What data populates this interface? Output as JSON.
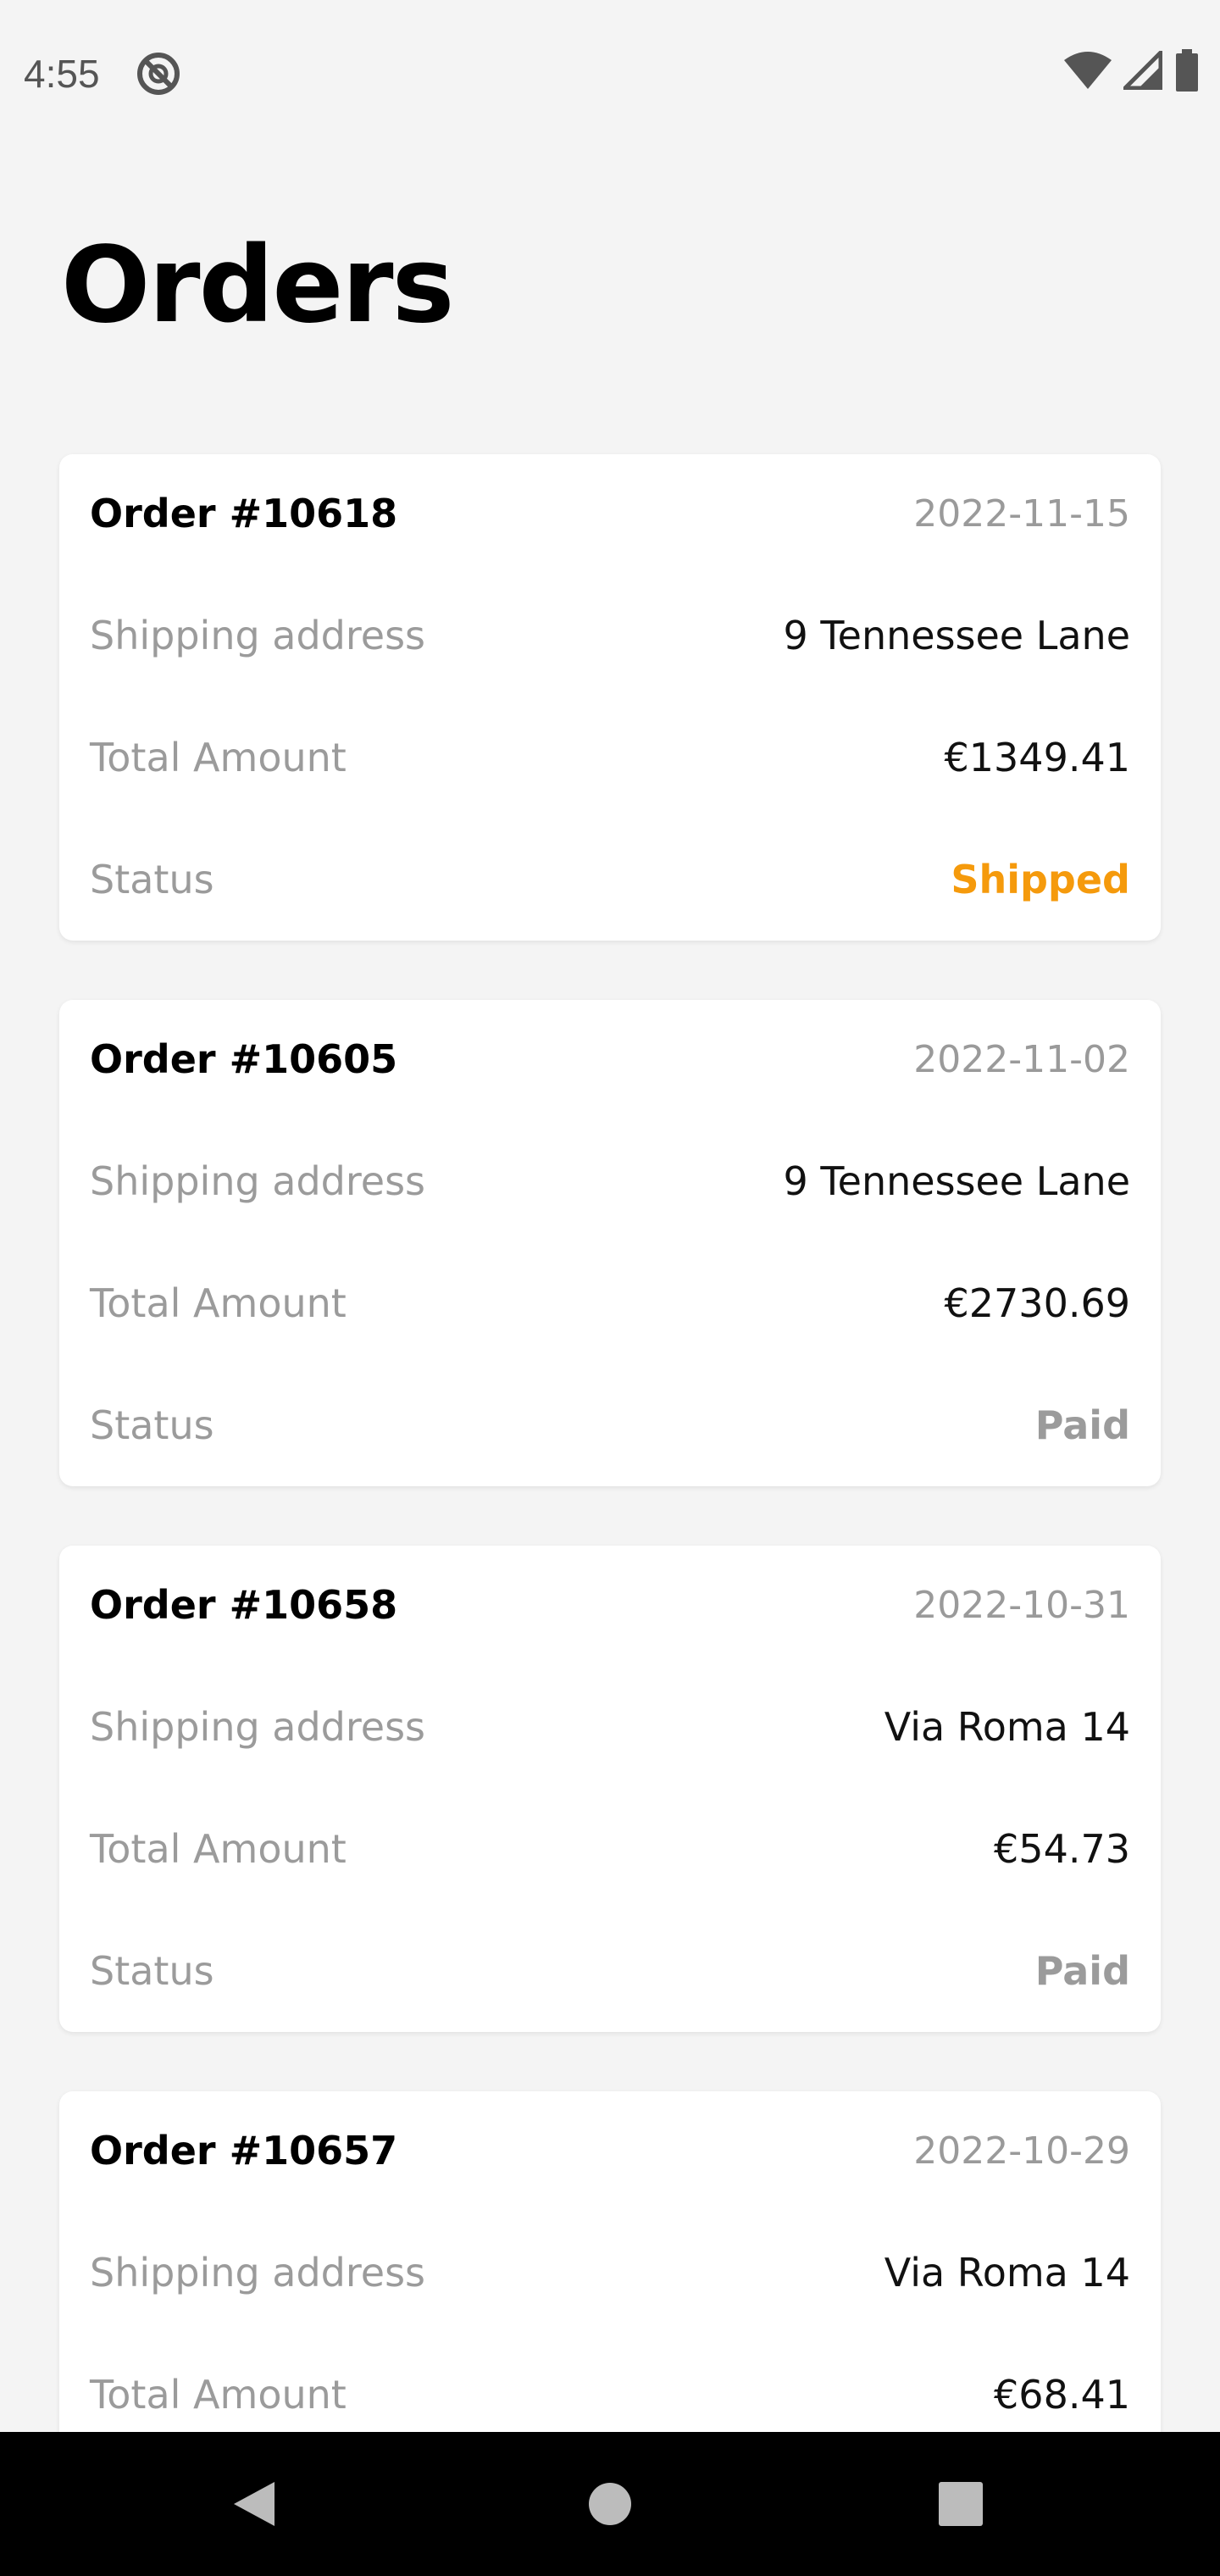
{
  "status_bar": {
    "time": "4:55",
    "icons": [
      "dnd-icon",
      "wifi-icon",
      "cellular-icon",
      "battery-icon"
    ]
  },
  "page": {
    "title": "Orders"
  },
  "labels": {
    "shipping_address": "Shipping address",
    "total_amount": "Total Amount",
    "status": "Status"
  },
  "colors": {
    "shipped": "#f59a0c",
    "paid": "#9b9b9b"
  },
  "orders": [
    {
      "number": "Order #10618",
      "date": "2022-11-15",
      "shipping_address": "9 Tennessee Lane",
      "total_amount": "€1349.41",
      "status": "Shipped"
    },
    {
      "number": "Order #10605",
      "date": "2022-11-02",
      "shipping_address": "9 Tennessee Lane",
      "total_amount": "€2730.69",
      "status": "Paid"
    },
    {
      "number": "Order #10658",
      "date": "2022-10-31",
      "shipping_address": "Via Roma 14",
      "total_amount": "€54.73",
      "status": "Paid"
    },
    {
      "number": "Order #10657",
      "date": "2022-10-29",
      "shipping_address": "Via Roma 14",
      "total_amount": "€68.41",
      "status": ""
    }
  ],
  "nav": {
    "buttons": [
      "back-icon",
      "home-icon",
      "recents-icon"
    ]
  }
}
